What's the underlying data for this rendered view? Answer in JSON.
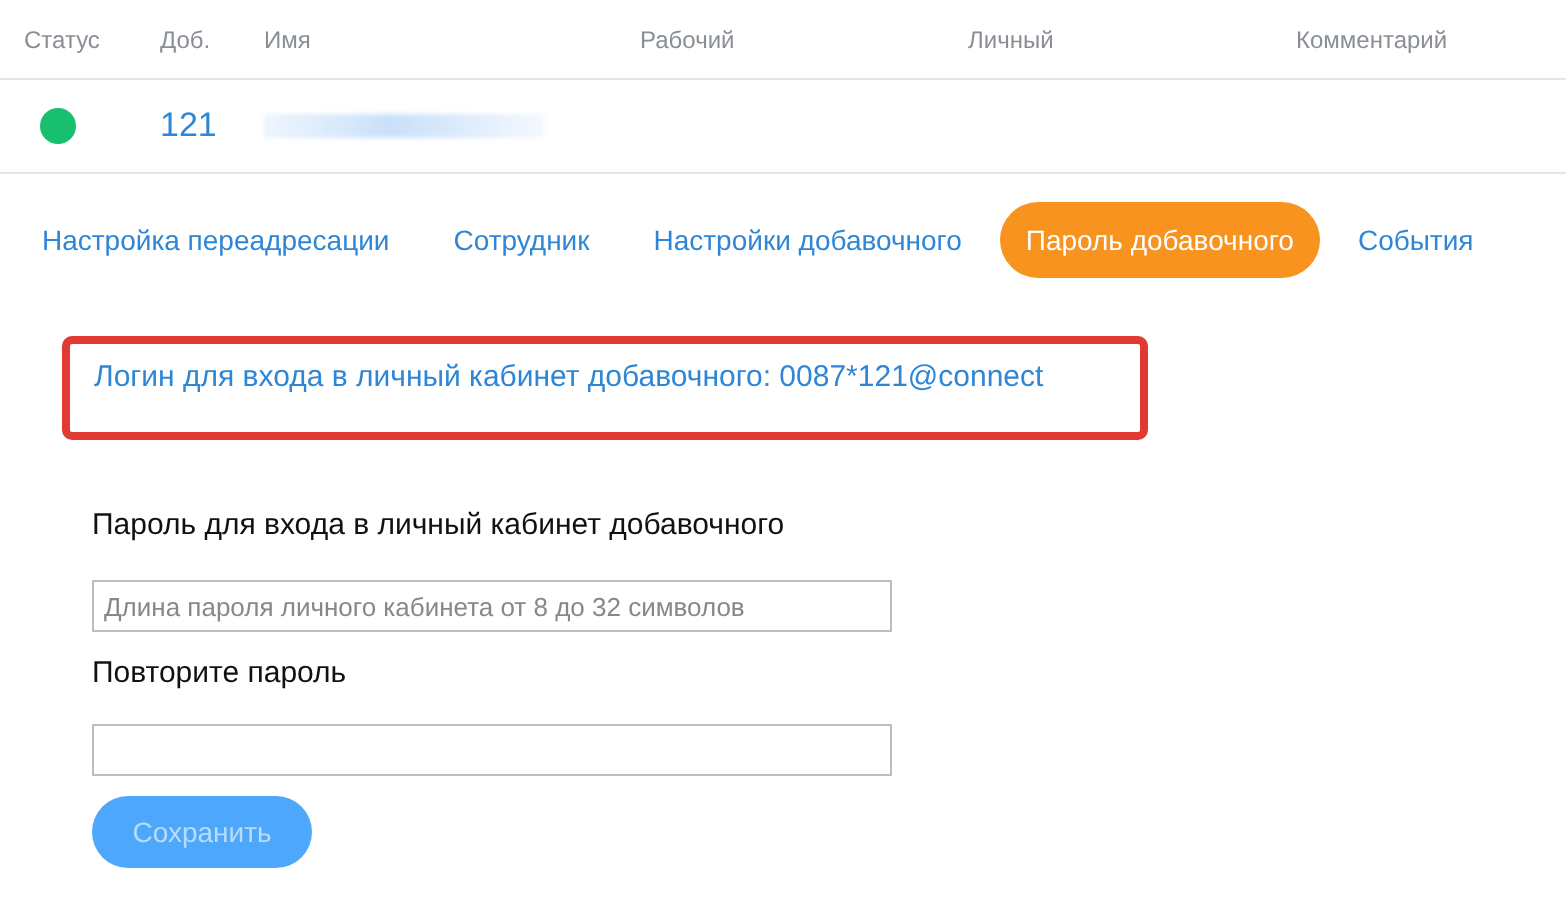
{
  "table": {
    "columns": [
      "Статус",
      "Доб.",
      "Имя",
      "Рабочий",
      "Личный",
      "Комментарий"
    ],
    "rows": [
      {
        "color": "#17bf6e",
        "extension": "121"
      }
    ]
  },
  "tabs": [
    {
      "label": "Настройка переадресации",
      "selected": false
    },
    {
      "label": "Сотрудник",
      "selected": false
    },
    {
      "label": "Настройки добавочного",
      "selected": false
    },
    {
      "label": "Пароль добавочного",
      "selected": true
    },
    {
      "label": "События",
      "selected": false
    }
  ],
  "login_notice": "Логин для входа в личный кабинет добавочного: 0087*121@connect",
  "form": {
    "fields": [
      {
        "label": "Пароль для входа в личный кабинет добавочного",
        "placeholder": "Длина пароля личного кабинета от 8 до 32 символов"
      },
      {
        "label": "Повторите пароль"
      }
    ],
    "save_button": {
      "label": "Сохранить",
      "disabled": true
    }
  }
}
